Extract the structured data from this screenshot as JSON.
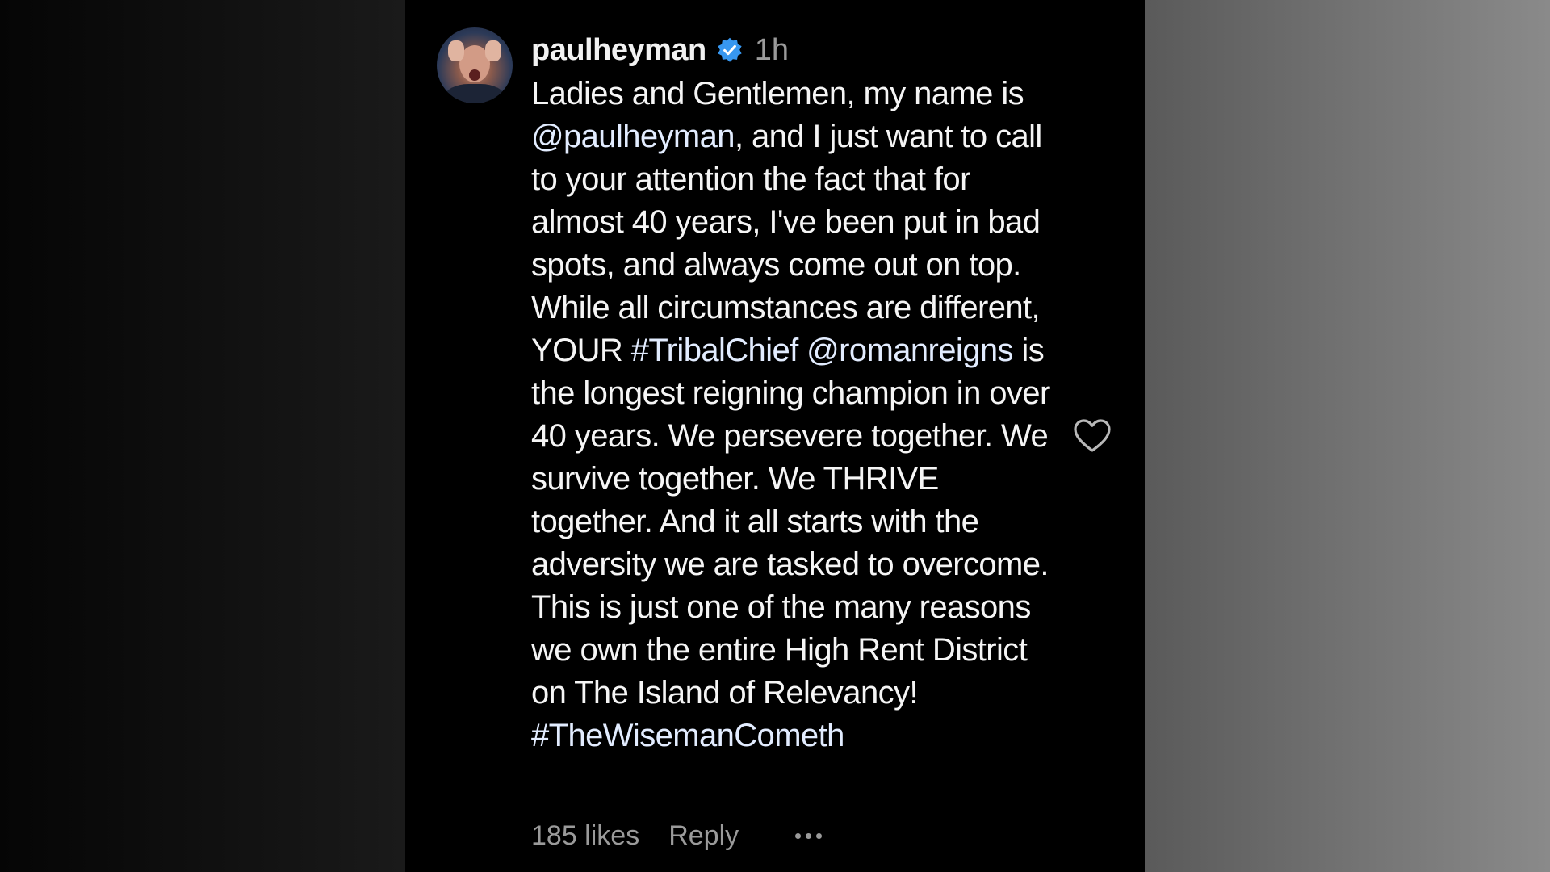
{
  "comment": {
    "username": "paulheyman",
    "verified": true,
    "timestamp": "1h",
    "segments": [
      {
        "text": "Ladies and Gentlemen, my name is ",
        "type": "text"
      },
      {
        "text": "@paulheyman",
        "type": "mention"
      },
      {
        "text": ", and I just want to call to your attention the fact that for almost 40 years, I've been put in bad spots, and always come out on top. While all circumstances are different, YOUR ",
        "type": "text"
      },
      {
        "text": "#TribalChief",
        "type": "hashtag"
      },
      {
        "text": " ",
        "type": "text"
      },
      {
        "text": "@romanreigns",
        "type": "mention"
      },
      {
        "text": " is the longest reigning champion in over 40 years. We persevere together. We survive together. We THRIVE together. And it all starts with the adversity we are tasked to overcome. This is just one of the many reasons we own the entire High Rent District on The Island of Relevancy! ",
        "type": "text"
      },
      {
        "text": "#TheWisemanCometh",
        "type": "hashtag"
      }
    ],
    "likes": "185 likes",
    "reply_label": "Reply",
    "more_icon": "more-options-icon",
    "like_icon": "heart-icon"
  },
  "colors": {
    "panel_background": "#000000",
    "text": "#f5f5f5",
    "muted": "#9a9a9a",
    "link": "#e2ecff",
    "verified_badge": "#3797f0"
  }
}
